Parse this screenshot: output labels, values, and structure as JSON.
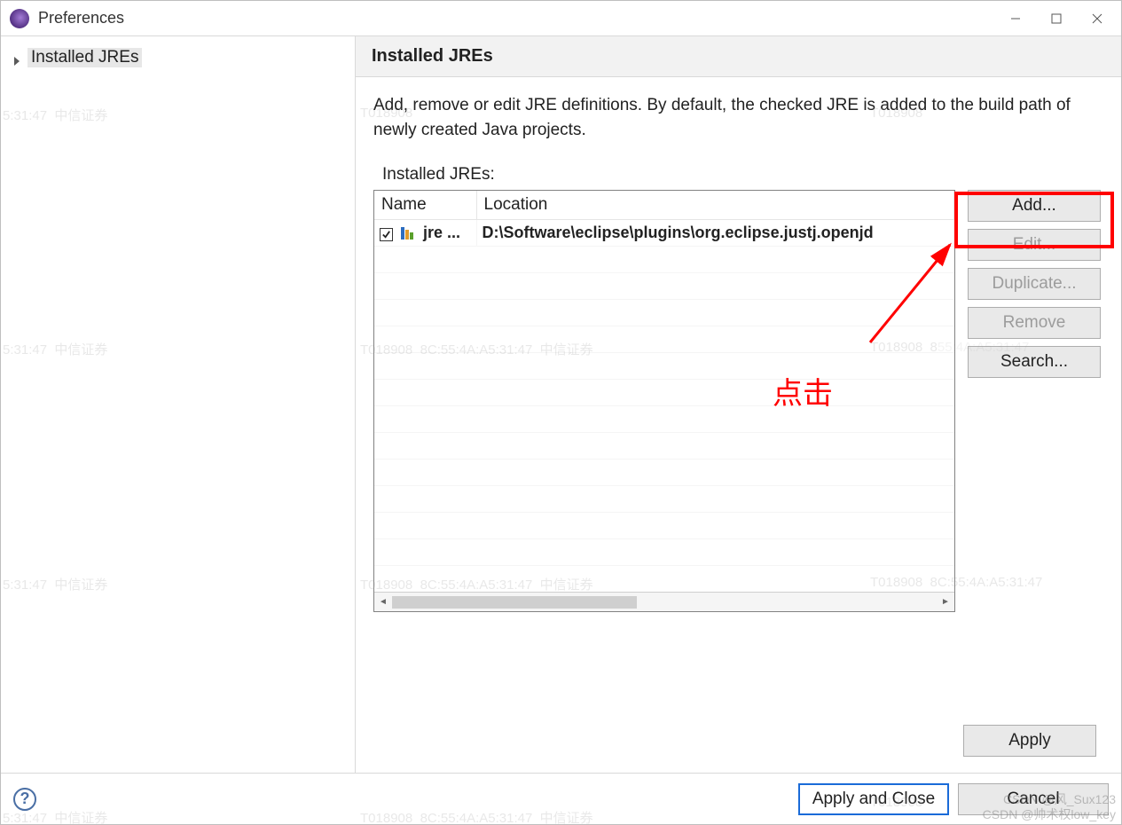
{
  "window": {
    "title": "Preferences"
  },
  "sidebar": {
    "items": [
      {
        "label": "Installed JREs"
      }
    ]
  },
  "page": {
    "heading": "Installed JREs",
    "description": "Add, remove or edit JRE definitions. By default, the checked JRE is added to the build path of newly created Java projects.",
    "list_label": "Installed JREs:",
    "columns": {
      "name": "Name",
      "location": "Location"
    },
    "rows": [
      {
        "checked": true,
        "name": "jre ...",
        "location": "D:\\Software\\eclipse\\plugins\\org.eclipse.justj.openjd"
      }
    ]
  },
  "buttons": {
    "add": "Add...",
    "edit": "Edit...",
    "duplicate": "Duplicate...",
    "remove": "Remove",
    "search": "Search...",
    "apply": "Apply",
    "apply_close": "Apply and Close",
    "cancel": "Cancel"
  },
  "annotations": {
    "click_label": "点击"
  },
  "watermark": {
    "left_time": "5:31:47",
    "left_text": "中信证券",
    "mid_id": "T018908",
    "mid_mac": "8C:55:4A:A5:31:47",
    "mid_text": "中信证券",
    "right_id": "T018908",
    "right_mac": "55:4A:A5:31:47",
    "csdn1": "CSDN @风_Sux123",
    "csdn2": "CSDN @帅术权low_key"
  }
}
